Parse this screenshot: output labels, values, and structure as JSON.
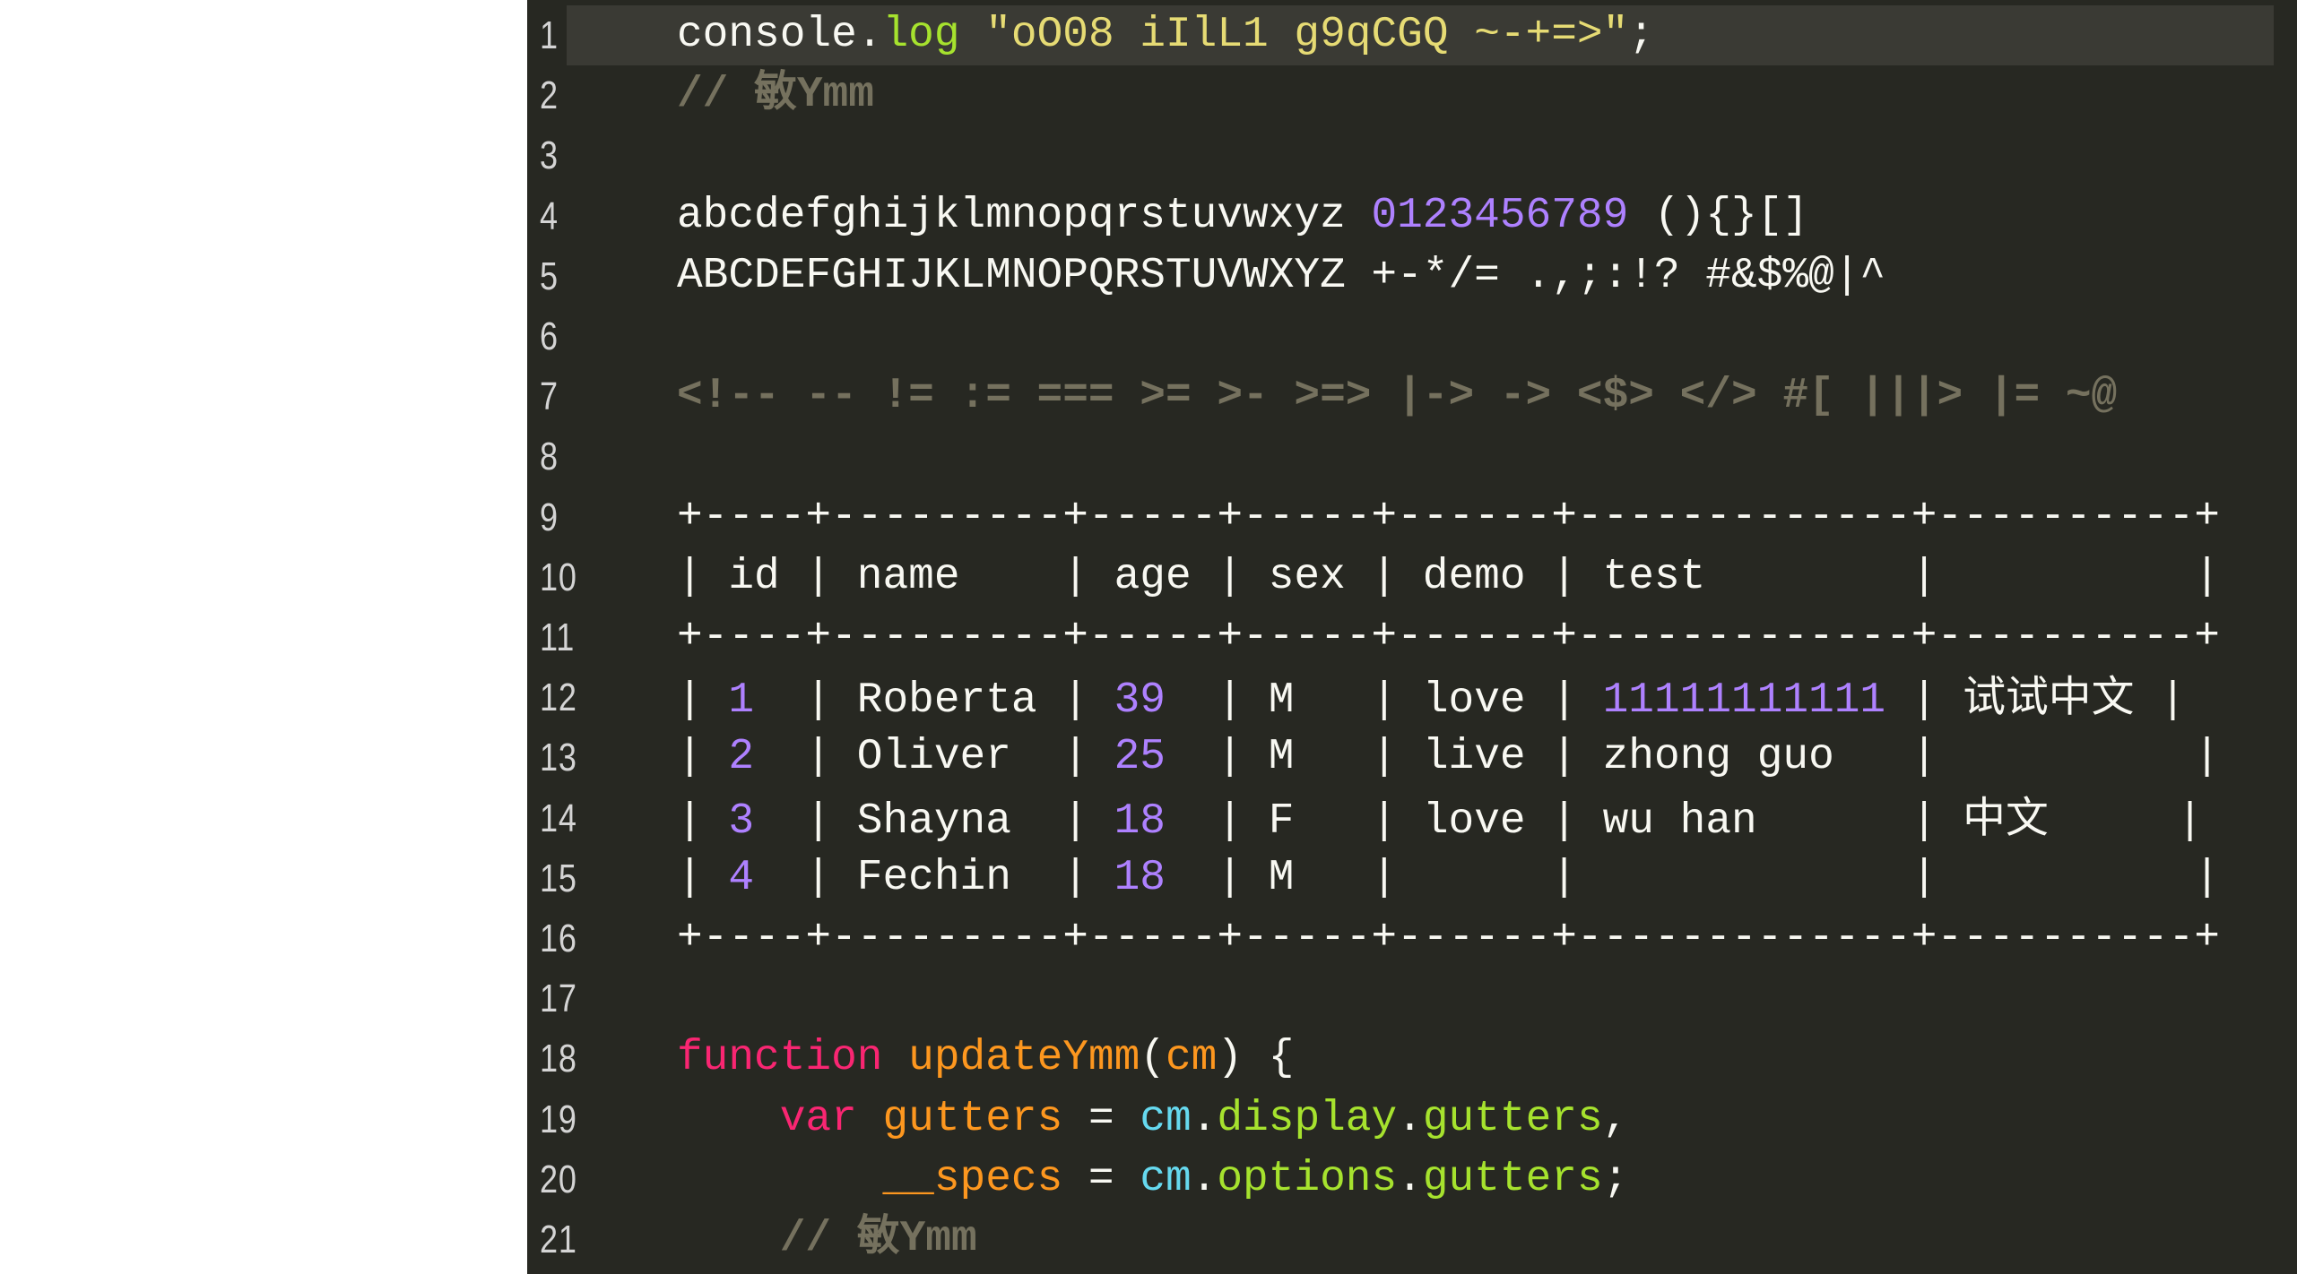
{
  "editor": {
    "theme_colors": {
      "background": "#272822",
      "active_line": "#3a3a34",
      "plain": "#f8f8f2",
      "property": "#a6e22e",
      "string": "#e6db74",
      "number": "#ae81ff",
      "keyword": "#f92672",
      "definition": "#fd971f",
      "variable": "#66d9ef",
      "comment": "#75715e"
    },
    "active_line": 1,
    "lines": [
      {
        "n": "1",
        "tokens": [
          [
            "plain",
            "console."
          ],
          [
            "prop",
            "log"
          ],
          [
            "plain",
            " "
          ],
          [
            "str",
            "\"oO08 iIlL1 g9qCGQ ~-+=>\""
          ],
          [
            "plain",
            ";"
          ]
        ]
      },
      {
        "n": "2",
        "tokens": [
          [
            "comment",
            "// 敏Ymm"
          ]
        ]
      },
      {
        "n": "3",
        "tokens": []
      },
      {
        "n": "4",
        "tokens": [
          [
            "plain",
            "abcdefghijklmnopqrstuvwxyz "
          ],
          [
            "num",
            "0123456789"
          ],
          [
            "plain",
            " (){}[]"
          ]
        ]
      },
      {
        "n": "5",
        "tokens": [
          [
            "plain",
            "ABCDEFGHIJKLMNOPQRSTUVWXYZ +-*/= .,;:!? #&$%@|^"
          ]
        ]
      },
      {
        "n": "6",
        "tokens": []
      },
      {
        "n": "7",
        "tokens": [
          [
            "comment",
            "<!-- -- != := === >= >- >=> |-> -> <$> </> #[ |||> |= ~@"
          ]
        ]
      },
      {
        "n": "8",
        "tokens": []
      },
      {
        "n": "9",
        "tokens": [
          [
            "plain",
            "+----+---------+-----+-----+------+-------------+----------+"
          ]
        ]
      },
      {
        "n": "10",
        "tokens": [
          [
            "plain",
            "| id | name    | age | sex | demo | test        |          |"
          ]
        ]
      },
      {
        "n": "11",
        "tokens": [
          [
            "plain",
            "+----+---------+-----+-----+------+-------------+----------+"
          ]
        ]
      },
      {
        "n": "12",
        "tokens": [
          [
            "plain",
            "| "
          ],
          [
            "num",
            "1"
          ],
          [
            "plain",
            "  | Roberta | "
          ],
          [
            "num",
            "39"
          ],
          [
            "plain",
            "  | M   | love | "
          ],
          [
            "num",
            "11111111111"
          ],
          [
            "plain",
            " | "
          ],
          [
            "cjk",
            "试试中文"
          ],
          [
            "plain",
            " |"
          ]
        ]
      },
      {
        "n": "13",
        "tokens": [
          [
            "plain",
            "| "
          ],
          [
            "num",
            "2"
          ],
          [
            "plain",
            "  | Oliver  | "
          ],
          [
            "num",
            "25"
          ],
          [
            "plain",
            "  | M   | live | zhong guo   |          |"
          ]
        ]
      },
      {
        "n": "14",
        "tokens": [
          [
            "plain",
            "| "
          ],
          [
            "num",
            "3"
          ],
          [
            "plain",
            "  | Shayna  | "
          ],
          [
            "num",
            "18"
          ],
          [
            "plain",
            "  | F   | love | wu han      | "
          ],
          [
            "cjk",
            "中文"
          ],
          [
            "plain",
            "     |"
          ]
        ]
      },
      {
        "n": "15",
        "tokens": [
          [
            "plain",
            "| "
          ],
          [
            "num",
            "4"
          ],
          [
            "plain",
            "  | Fechin  | "
          ],
          [
            "num",
            "18"
          ],
          [
            "plain",
            "  | M   |      |             |          |"
          ]
        ]
      },
      {
        "n": "16",
        "tokens": [
          [
            "plain",
            "+----+---------+-----+-----+------+-------------+----------+"
          ]
        ]
      },
      {
        "n": "17",
        "tokens": []
      },
      {
        "n": "18",
        "tokens": [
          [
            "kw",
            "function"
          ],
          [
            "plain",
            " "
          ],
          [
            "def",
            "updateYmm"
          ],
          [
            "plain",
            "("
          ],
          [
            "def",
            "cm"
          ],
          [
            "plain",
            ") {"
          ]
        ]
      },
      {
        "n": "19",
        "tokens": [
          [
            "plain",
            "    "
          ],
          [
            "kw",
            "var"
          ],
          [
            "plain",
            " "
          ],
          [
            "def",
            "gutters"
          ],
          [
            "plain",
            " = "
          ],
          [
            "var",
            "cm"
          ],
          [
            "plain",
            "."
          ],
          [
            "prop",
            "display"
          ],
          [
            "plain",
            "."
          ],
          [
            "prop",
            "gutters"
          ],
          [
            "plain",
            ","
          ]
        ]
      },
      {
        "n": "20",
        "tokens": [
          [
            "plain",
            "        "
          ],
          [
            "def",
            "__specs"
          ],
          [
            "plain",
            " = "
          ],
          [
            "var",
            "cm"
          ],
          [
            "plain",
            "."
          ],
          [
            "prop",
            "options"
          ],
          [
            "plain",
            "."
          ],
          [
            "prop",
            "gutters"
          ],
          [
            "plain",
            ";"
          ]
        ]
      },
      {
        "n": "21",
        "tokens": [
          [
            "plain",
            "    "
          ],
          [
            "comment",
            "// 敏Ymm"
          ]
        ]
      }
    ]
  }
}
